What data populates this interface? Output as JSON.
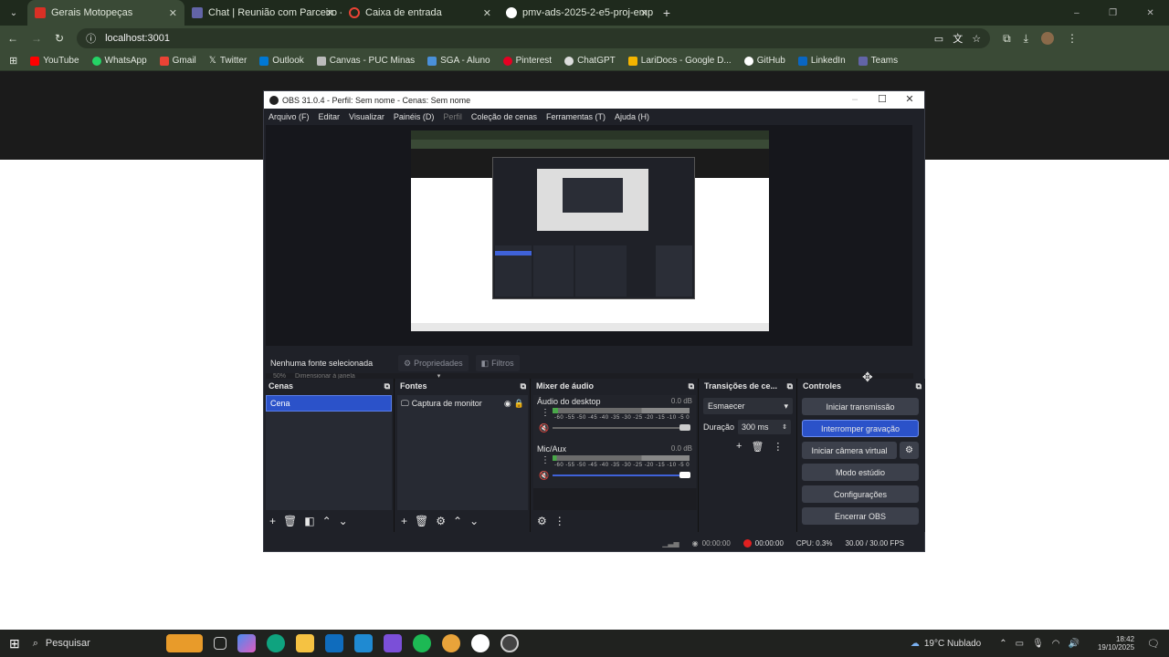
{
  "browser": {
    "tabs": [
      {
        "title": "Gerais Motopeças",
        "active": true,
        "color": "#d93025"
      },
      {
        "title": "Chat | Reunião com Parceiro - I",
        "active": false,
        "color": "#6264a7"
      },
      {
        "title": "Caixa de entrada",
        "active": false,
        "color": "#ea4335"
      },
      {
        "title": "pmv-ads-2025-2-e5-proj-emp",
        "active": false,
        "color": "#ffffff"
      }
    ],
    "url": "localhost:3001",
    "bookmarks": [
      {
        "label": "YouTube",
        "color": "#ff0000"
      },
      {
        "label": "WhatsApp",
        "color": "#25d366"
      },
      {
        "label": "Gmail",
        "color": "#ea4335"
      },
      {
        "label": "Twitter",
        "color": "#cccccc"
      },
      {
        "label": "Outlook",
        "color": "#0078d4"
      },
      {
        "label": "Canvas - PUC Minas",
        "color": "#bbbbbb"
      },
      {
        "label": "SGA - Aluno",
        "color": "#4a90d9"
      },
      {
        "label": "Pinterest",
        "color": "#e60023"
      },
      {
        "label": "ChatGPT",
        "color": "#dddddd"
      },
      {
        "label": "LariDocs - Google D...",
        "color": "#f4b400"
      },
      {
        "label": "GitHub",
        "color": "#ffffff"
      },
      {
        "label": "LinkedIn",
        "color": "#0a66c2"
      },
      {
        "label": "Teams",
        "color": "#6264a7"
      }
    ]
  },
  "obs": {
    "title": "OBS 31.0.4 - Perfil: Sem nome - Cenas: Sem nome",
    "menu": [
      "Arquivo (F)",
      "Editar",
      "Visualizar",
      "Painéis (D)",
      "Perfil",
      "Coleção de cenas",
      "Ferramentas (T)",
      "Ajuda (H)"
    ],
    "zoom": "50%",
    "zoom_mode": "Dimensionar à janela",
    "no_source": "Nenhuma fonte selecionada",
    "properties": "Propriedades",
    "filters": "Filtros",
    "scenes": {
      "title": "Cenas",
      "items": [
        "Cena"
      ]
    },
    "sources": {
      "title": "Fontes",
      "items": [
        "Captura de monitor"
      ]
    },
    "mixer": {
      "title": "Mixer de áudio",
      "channels": [
        {
          "name": "Áudio do desktop",
          "db": "0.0 dB",
          "volume": 1.0,
          "muted": true
        },
        {
          "name": "Mic/Aux",
          "db": "0.0 dB",
          "volume": 1.0,
          "muted": true
        }
      ],
      "ticks": "-60 -55 -50 -45 -40 -35 -30 -25 -20 -15 -10 -5 0"
    },
    "transitions": {
      "title": "Transições de ce...",
      "type": "Esmaecer",
      "duration_label": "Duração",
      "duration": "300 ms"
    },
    "controls": {
      "title": "Controles",
      "buttons": [
        "Iniciar transmissão",
        "Interromper gravação",
        "Iniciar câmera virtual",
        "Modo estúdio",
        "Configurações",
        "Encerrar OBS"
      ]
    },
    "status": {
      "stream_time": "00:00:00",
      "rec_time": "00:00:00",
      "cpu": "CPU: 0.3%",
      "fps": "30.00 / 30.00 FPS"
    }
  },
  "taskbar": {
    "search": "Pesquisar",
    "weather": "19°C  Nublado",
    "time": "18:42",
    "date": "19/10/2025"
  }
}
